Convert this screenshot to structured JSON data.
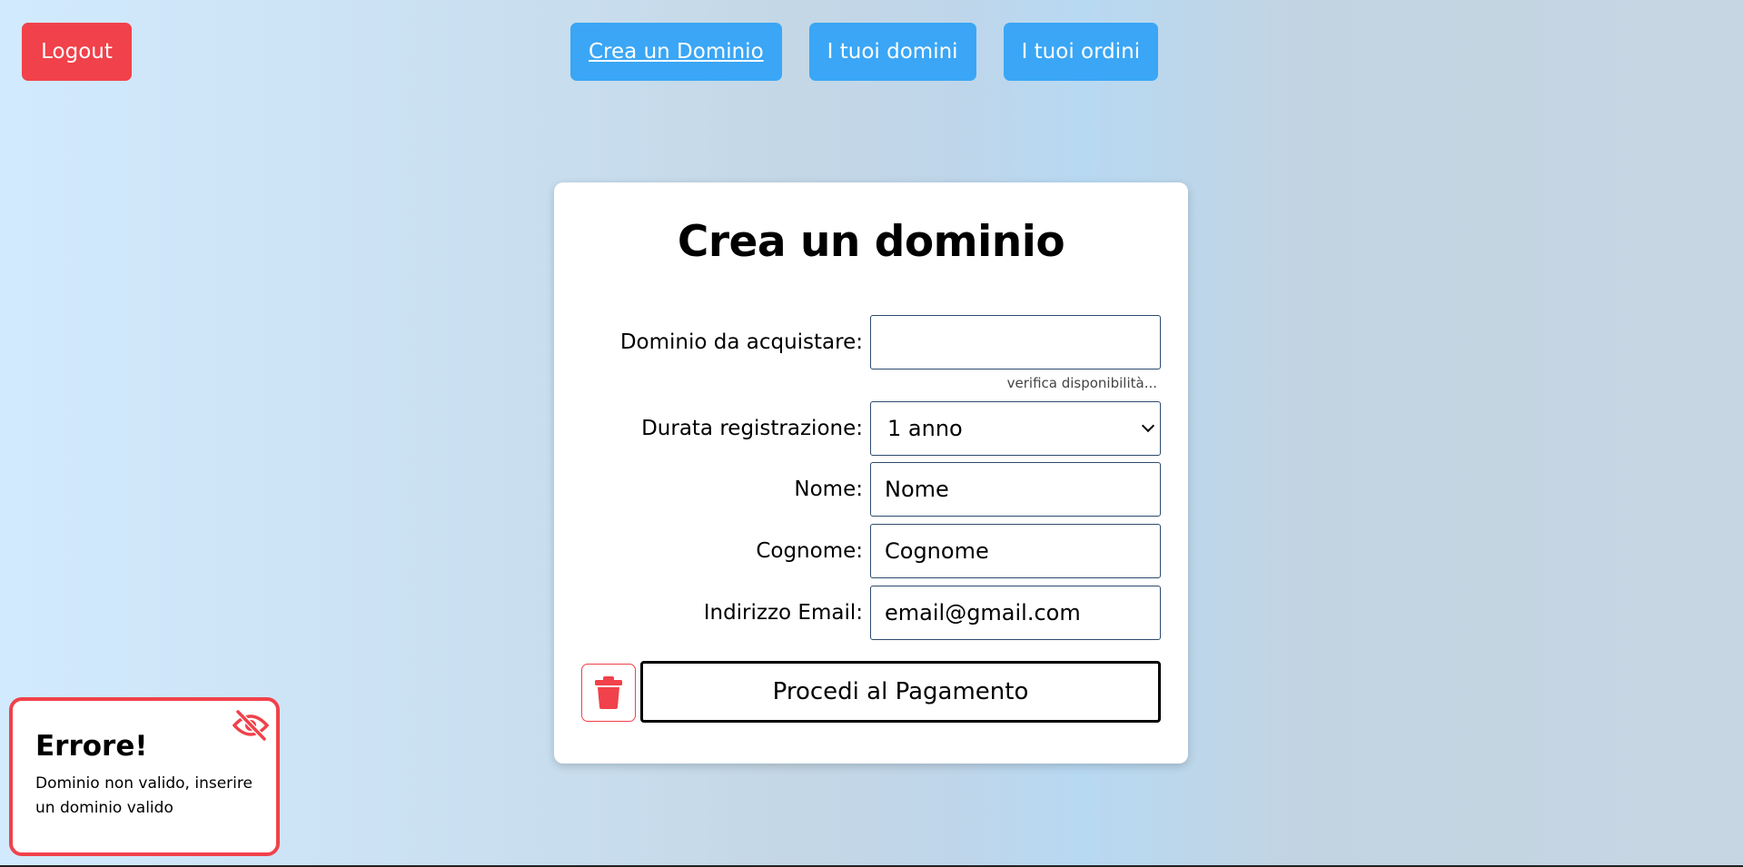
{
  "header": {
    "logout_label": "Logout",
    "nav": [
      {
        "label": "Crea un Dominio",
        "active": true
      },
      {
        "label": "I tuoi domini",
        "active": false
      },
      {
        "label": "I tuoi ordini",
        "active": false
      }
    ]
  },
  "form": {
    "title": "Crea un dominio",
    "domain": {
      "label": "Dominio da acquistare:",
      "value": ""
    },
    "availability_hint": "verifica disponibilità...",
    "duration": {
      "label": "Durata registrazione:",
      "selected": "1 anno"
    },
    "first_name": {
      "label": "Nome:",
      "value": "Nome"
    },
    "last_name": {
      "label": "Cognome:",
      "value": "Cognome"
    },
    "email": {
      "label": "Indirizzo Email:",
      "value": "email@gmail.com"
    },
    "pay_label": "Procedi al Pagamento",
    "delete_icon": "trash-icon"
  },
  "toast": {
    "title": "Errore!",
    "message": "Dominio non valido, inserire un dominio valido",
    "hide_icon": "eye-slash-icon"
  },
  "colors": {
    "danger": "#f1414a",
    "primary": "#3aa6f5",
    "input_border": "#2c4a6e"
  }
}
